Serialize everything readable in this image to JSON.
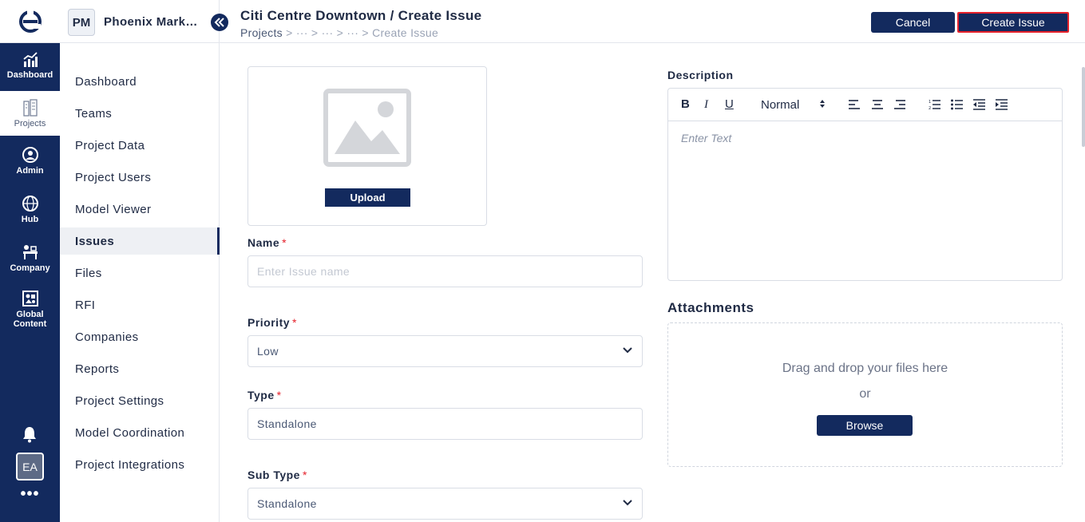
{
  "rail": {
    "items": [
      {
        "label": "Dashboard",
        "icon": "dashboard-chart-icon"
      },
      {
        "label": "Projects",
        "icon": "projects-building-icon"
      },
      {
        "label": "Admin",
        "icon": "admin-user-icon"
      },
      {
        "label": "Hub",
        "icon": "hub-globe-icon"
      },
      {
        "label": "Company",
        "icon": "company-desk-icon"
      },
      {
        "label": "Global Content",
        "icon": "global-content-icon"
      }
    ],
    "active": "Projects",
    "avatar": "EA",
    "more": "•••"
  },
  "project": {
    "badge": "PM",
    "name": "Phoenix Mark…"
  },
  "sidebar": {
    "items": [
      {
        "label": "Dashboard"
      },
      {
        "label": "Teams"
      },
      {
        "label": "Project Data"
      },
      {
        "label": "Project Users"
      },
      {
        "label": "Model Viewer"
      },
      {
        "label": "Issues"
      },
      {
        "label": "Files"
      },
      {
        "label": "RFI"
      },
      {
        "label": "Companies"
      },
      {
        "label": "Reports"
      },
      {
        "label": "Project Settings"
      },
      {
        "label": "Model Coordination"
      },
      {
        "label": "Project Integrations"
      }
    ],
    "active": "Issues"
  },
  "header": {
    "title": "Citi Centre Downtown / Create Issue",
    "breadcrumb_first": "Projects",
    "breadcrumb_rest": " >  ···  >  ···  >  ···  >  Create Issue",
    "cancel_label": "Cancel",
    "create_label": "Create Issue"
  },
  "form": {
    "upload_label": "Upload",
    "name_label": "Name",
    "name_placeholder": "Enter Issue name",
    "required_mark": "*",
    "priority_label": "Priority",
    "priority_value": "Low",
    "type_label": "Type",
    "type_value": "Standalone",
    "subtype_label": "Sub Type",
    "subtype_value": "Standalone"
  },
  "description": {
    "label": "Description",
    "format_value": "Normal",
    "placeholder": "Enter Text"
  },
  "attachments": {
    "title": "Attachments",
    "drop_text": "Drag and drop your files here",
    "or_text": "or",
    "browse_label": "Browse"
  },
  "colors": {
    "navy": "#132a5e",
    "required": "#e5212b",
    "highlight_border": "#e5212b"
  }
}
